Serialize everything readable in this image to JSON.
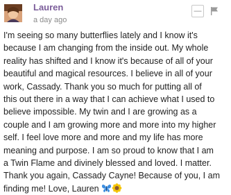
{
  "comment": {
    "author": "Lauren",
    "timestamp": "a day ago",
    "body_lines": [
      "I'm seeing so many butterflies lately and I know it's",
      "because I am changing from the inside out. My whole",
      "reality has shifted and I know it's because of all of your",
      "beautiful and magical resources. I believe in all of your",
      "work, Cassady. Thank you so much for putting all of",
      "this out there in a way that I can achieve what I used to",
      "believe impossible. My twin and I are growing as a",
      "couple and I am growing more and more into my higher",
      "self. I feel love more and more and my life has more",
      "meaning and purpose. I am so proud to know that I am",
      "a Twin Flame and divinely blessed and loved. I matter.",
      "Thank you again, Cassady Cayne! Because of you, I am",
      "finding me! Love, Lauren"
    ],
    "emojis": [
      "butterfly-emoji",
      "sunflower-emoji"
    ]
  },
  "controls": {
    "collapse_symbol": "—",
    "flag_icon": "flag-icon"
  },
  "colors": {
    "author": "#7a5c99",
    "timestamp": "#8a8a8a",
    "body": "#222222",
    "butterfly": "#3f8fe0",
    "sunflower_petal": "#f5c400",
    "sunflower_center": "#8b5a2b"
  }
}
